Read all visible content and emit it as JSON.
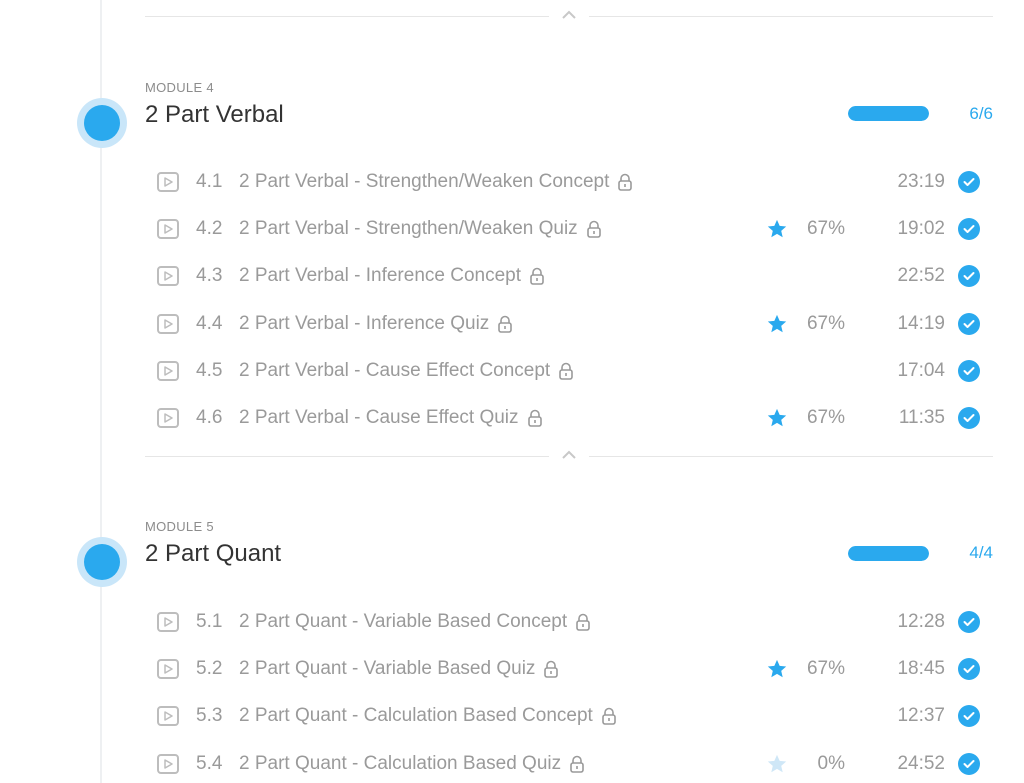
{
  "colors": {
    "accent": "#2aa9ee",
    "text_muted": "#9a9a9a",
    "heading": "#333333",
    "star_active": "#2aa9ee",
    "star_inactive": "#cfe7f7"
  },
  "modules": [
    {
      "label": "MODULE 4",
      "title": "2 Part Verbal",
      "progress_fraction": 1.0,
      "progress_count": "6/6",
      "lessons": [
        {
          "num": "4.1",
          "title": "2 Part Verbal - Strengthen/Weaken Concept",
          "score": "",
          "star": "none",
          "duration": "23:19",
          "completed": true
        },
        {
          "num": "4.2",
          "title": "2 Part Verbal - Strengthen/Weaken Quiz",
          "score": "67%",
          "star": "active",
          "duration": "19:02",
          "completed": true
        },
        {
          "num": "4.3",
          "title": "2 Part Verbal - Inference Concept",
          "score": "",
          "star": "none",
          "duration": "22:52",
          "completed": true
        },
        {
          "num": "4.4",
          "title": "2 Part Verbal - Inference Quiz",
          "score": "67%",
          "star": "active",
          "duration": "14:19",
          "completed": true
        },
        {
          "num": "4.5",
          "title": "2 Part Verbal - Cause Effect Concept",
          "score": "",
          "star": "none",
          "duration": "17:04",
          "completed": true
        },
        {
          "num": "4.6",
          "title": "2 Part Verbal - Cause Effect Quiz",
          "score": "67%",
          "star": "active",
          "duration": "11:35",
          "completed": true
        }
      ]
    },
    {
      "label": "MODULE 5",
      "title": "2 Part Quant",
      "progress_fraction": 1.0,
      "progress_count": "4/4",
      "lessons": [
        {
          "num": "5.1",
          "title": "2 Part Quant - Variable Based Concept",
          "score": "",
          "star": "none",
          "duration": "12:28",
          "completed": true
        },
        {
          "num": "5.2",
          "title": "2 Part Quant - Variable Based Quiz",
          "score": "67%",
          "star": "active",
          "duration": "18:45",
          "completed": true
        },
        {
          "num": "5.3",
          "title": "2 Part Quant - Calculation Based Concept",
          "score": "",
          "star": "none",
          "duration": "12:37",
          "completed": true
        },
        {
          "num": "5.4",
          "title": "2 Part Quant - Calculation Based Quiz",
          "score": "0%",
          "star": "inactive",
          "duration": "24:52",
          "completed": true
        }
      ]
    }
  ]
}
